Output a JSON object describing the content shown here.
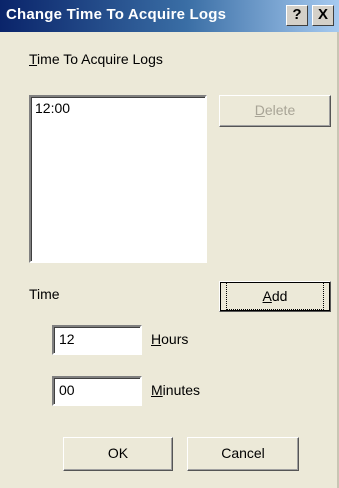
{
  "window": {
    "title": "Change Time To Acquire Logs",
    "help_button": "?",
    "close_button": "X"
  },
  "schedule": {
    "label_mnemonic": "T",
    "label_rest": "ime To Acquire Logs",
    "items": [
      "12:00"
    ],
    "delete_mnemonic": "D",
    "delete_rest": "elete"
  },
  "time": {
    "label": "Time",
    "add_mnemonic": "A",
    "add_rest": "dd",
    "hours_value": "12",
    "hours_mnemonic": "H",
    "hours_rest": "ours",
    "minutes_value": "00",
    "minutes_mnemonic": "M",
    "minutes_rest": "inutes"
  },
  "footer": {
    "ok_label": "OK",
    "cancel_label": "Cancel"
  },
  "colors": {
    "titlebar_start": "#0a246a",
    "titlebar_end": "#a6caf0",
    "dialog_face": "#ece9d8",
    "disabled_text": "#a8a496"
  }
}
